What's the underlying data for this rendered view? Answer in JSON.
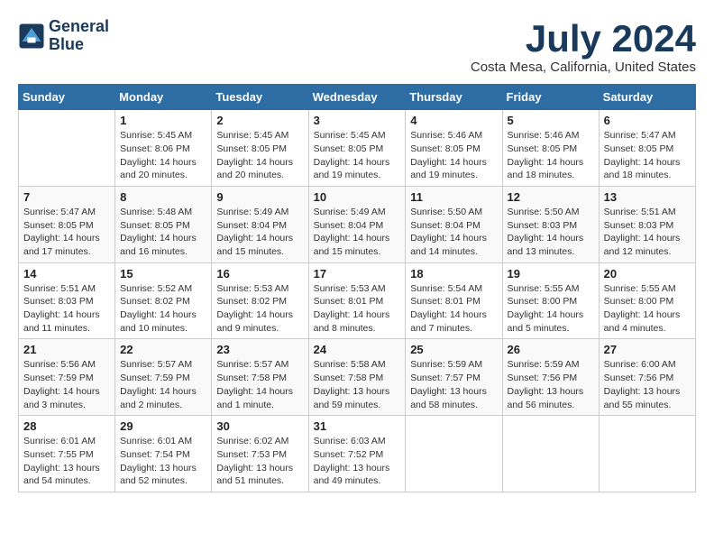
{
  "logo": {
    "line1": "General",
    "line2": "Blue"
  },
  "title": "July 2024",
  "location": "Costa Mesa, California, United States",
  "days_header": [
    "Sunday",
    "Monday",
    "Tuesday",
    "Wednesday",
    "Thursday",
    "Friday",
    "Saturday"
  ],
  "weeks": [
    [
      {
        "day": "",
        "info": ""
      },
      {
        "day": "1",
        "info": "Sunrise: 5:45 AM\nSunset: 8:06 PM\nDaylight: 14 hours\nand 20 minutes."
      },
      {
        "day": "2",
        "info": "Sunrise: 5:45 AM\nSunset: 8:05 PM\nDaylight: 14 hours\nand 20 minutes."
      },
      {
        "day": "3",
        "info": "Sunrise: 5:45 AM\nSunset: 8:05 PM\nDaylight: 14 hours\nand 19 minutes."
      },
      {
        "day": "4",
        "info": "Sunrise: 5:46 AM\nSunset: 8:05 PM\nDaylight: 14 hours\nand 19 minutes."
      },
      {
        "day": "5",
        "info": "Sunrise: 5:46 AM\nSunset: 8:05 PM\nDaylight: 14 hours\nand 18 minutes."
      },
      {
        "day": "6",
        "info": "Sunrise: 5:47 AM\nSunset: 8:05 PM\nDaylight: 14 hours\nand 18 minutes."
      }
    ],
    [
      {
        "day": "7",
        "info": "Sunrise: 5:47 AM\nSunset: 8:05 PM\nDaylight: 14 hours\nand 17 minutes."
      },
      {
        "day": "8",
        "info": "Sunrise: 5:48 AM\nSunset: 8:05 PM\nDaylight: 14 hours\nand 16 minutes."
      },
      {
        "day": "9",
        "info": "Sunrise: 5:49 AM\nSunset: 8:04 PM\nDaylight: 14 hours\nand 15 minutes."
      },
      {
        "day": "10",
        "info": "Sunrise: 5:49 AM\nSunset: 8:04 PM\nDaylight: 14 hours\nand 15 minutes."
      },
      {
        "day": "11",
        "info": "Sunrise: 5:50 AM\nSunset: 8:04 PM\nDaylight: 14 hours\nand 14 minutes."
      },
      {
        "day": "12",
        "info": "Sunrise: 5:50 AM\nSunset: 8:03 PM\nDaylight: 14 hours\nand 13 minutes."
      },
      {
        "day": "13",
        "info": "Sunrise: 5:51 AM\nSunset: 8:03 PM\nDaylight: 14 hours\nand 12 minutes."
      }
    ],
    [
      {
        "day": "14",
        "info": "Sunrise: 5:51 AM\nSunset: 8:03 PM\nDaylight: 14 hours\nand 11 minutes."
      },
      {
        "day": "15",
        "info": "Sunrise: 5:52 AM\nSunset: 8:02 PM\nDaylight: 14 hours\nand 10 minutes."
      },
      {
        "day": "16",
        "info": "Sunrise: 5:53 AM\nSunset: 8:02 PM\nDaylight: 14 hours\nand 9 minutes."
      },
      {
        "day": "17",
        "info": "Sunrise: 5:53 AM\nSunset: 8:01 PM\nDaylight: 14 hours\nand 8 minutes."
      },
      {
        "day": "18",
        "info": "Sunrise: 5:54 AM\nSunset: 8:01 PM\nDaylight: 14 hours\nand 7 minutes."
      },
      {
        "day": "19",
        "info": "Sunrise: 5:55 AM\nSunset: 8:00 PM\nDaylight: 14 hours\nand 5 minutes."
      },
      {
        "day": "20",
        "info": "Sunrise: 5:55 AM\nSunset: 8:00 PM\nDaylight: 14 hours\nand 4 minutes."
      }
    ],
    [
      {
        "day": "21",
        "info": "Sunrise: 5:56 AM\nSunset: 7:59 PM\nDaylight: 14 hours\nand 3 minutes."
      },
      {
        "day": "22",
        "info": "Sunrise: 5:57 AM\nSunset: 7:59 PM\nDaylight: 14 hours\nand 2 minutes."
      },
      {
        "day": "23",
        "info": "Sunrise: 5:57 AM\nSunset: 7:58 PM\nDaylight: 14 hours\nand 1 minute."
      },
      {
        "day": "24",
        "info": "Sunrise: 5:58 AM\nSunset: 7:58 PM\nDaylight: 13 hours\nand 59 minutes."
      },
      {
        "day": "25",
        "info": "Sunrise: 5:59 AM\nSunset: 7:57 PM\nDaylight: 13 hours\nand 58 minutes."
      },
      {
        "day": "26",
        "info": "Sunrise: 5:59 AM\nSunset: 7:56 PM\nDaylight: 13 hours\nand 56 minutes."
      },
      {
        "day": "27",
        "info": "Sunrise: 6:00 AM\nSunset: 7:56 PM\nDaylight: 13 hours\nand 55 minutes."
      }
    ],
    [
      {
        "day": "28",
        "info": "Sunrise: 6:01 AM\nSunset: 7:55 PM\nDaylight: 13 hours\nand 54 minutes."
      },
      {
        "day": "29",
        "info": "Sunrise: 6:01 AM\nSunset: 7:54 PM\nDaylight: 13 hours\nand 52 minutes."
      },
      {
        "day": "30",
        "info": "Sunrise: 6:02 AM\nSunset: 7:53 PM\nDaylight: 13 hours\nand 51 minutes."
      },
      {
        "day": "31",
        "info": "Sunrise: 6:03 AM\nSunset: 7:52 PM\nDaylight: 13 hours\nand 49 minutes."
      },
      {
        "day": "",
        "info": ""
      },
      {
        "day": "",
        "info": ""
      },
      {
        "day": "",
        "info": ""
      }
    ]
  ]
}
